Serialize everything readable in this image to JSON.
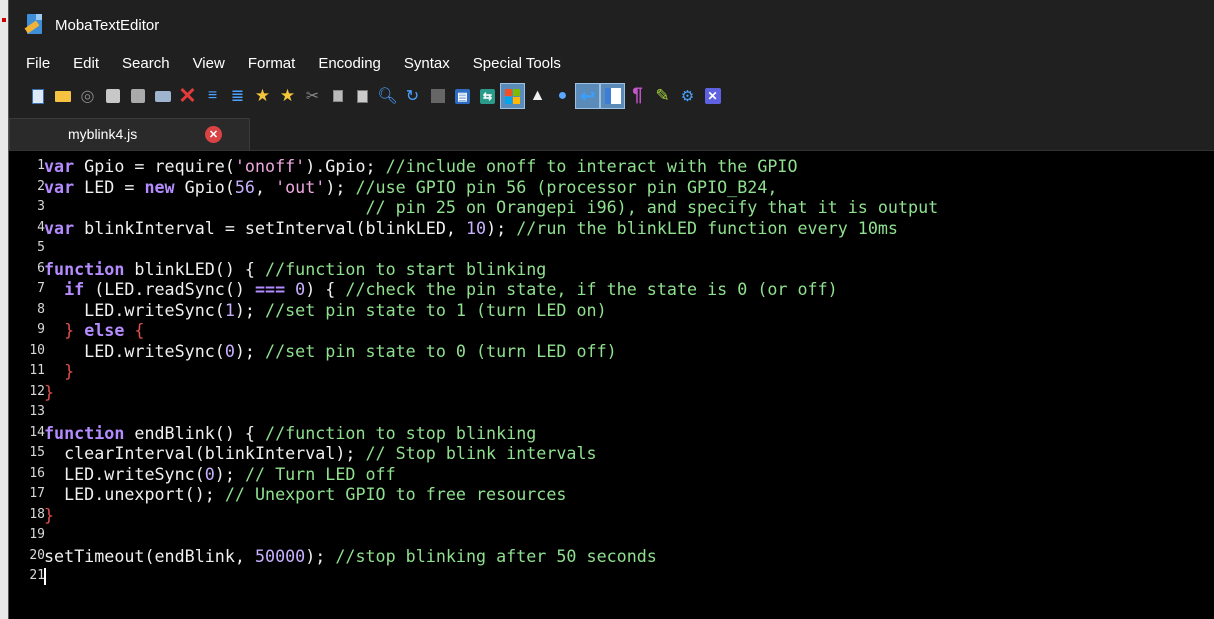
{
  "window": {
    "title": "MobaTextEditor",
    "app_icon": "mobatexteditor-icon"
  },
  "menu": [
    "File",
    "Edit",
    "Search",
    "View",
    "Format",
    "Encoding",
    "Syntax",
    "Special Tools"
  ],
  "toolbar": {
    "icons": [
      "new-file-icon",
      "open-folder-icon",
      "reload-icon",
      "save-icon",
      "save-all-icon",
      "print-icon",
      "close-icon",
      "indent-less-icon",
      "indent-more-icon",
      "bookmark-icon",
      "bookmark-next-icon",
      "cut-icon",
      "copy-icon",
      "paste-icon",
      "find-icon",
      "replace-icon",
      "compare-icon",
      "split-view-icon",
      "sync-icon",
      "windows-eol-icon",
      "linux-eol-icon",
      "mac-eol-icon",
      "word-wrap-icon",
      "side-panel-icon",
      "show-symbols-icon",
      "highlight-icon",
      "settings-icon",
      "exit-icon"
    ],
    "active_icons": [
      "windows-eol-icon",
      "word-wrap-icon",
      "side-panel-icon"
    ]
  },
  "tabs": [
    {
      "label": "myblink4.js",
      "closable": true
    }
  ],
  "editor": {
    "language": "javascript",
    "lines": [
      {
        "n": "1",
        "tokens": [
          [
            "kw",
            "var"
          ],
          [
            "t",
            " Gpio = require("
          ],
          [
            "str",
            "'onoff'"
          ],
          [
            "t",
            ").Gpio; "
          ],
          [
            "cm",
            "//include onoff to interact with the GPIO"
          ]
        ]
      },
      {
        "n": "2",
        "tokens": [
          [
            "kw",
            "var"
          ],
          [
            "t",
            " LED = "
          ],
          [
            "kw",
            "new"
          ],
          [
            "t",
            " Gpio("
          ],
          [
            "num",
            "56"
          ],
          [
            "t",
            ", "
          ],
          [
            "str",
            "'out'"
          ],
          [
            "t",
            "); "
          ],
          [
            "cm",
            "//use GPIO pin 56 (processor pin GPIO_B24,"
          ]
        ]
      },
      {
        "n": "3",
        "tokens": [
          [
            "t",
            "                                "
          ],
          [
            "cm",
            "// pin 25 on Orangepi i96), and specify that it is output"
          ]
        ]
      },
      {
        "n": "4",
        "tokens": [
          [
            "kw",
            "var"
          ],
          [
            "t",
            " blinkInterval = setInterval(blinkLED, "
          ],
          [
            "num",
            "10"
          ],
          [
            "t",
            "); "
          ],
          [
            "cm",
            "//run the blinkLED function every 10ms"
          ]
        ]
      },
      {
        "n": "5",
        "tokens": []
      },
      {
        "n": "6",
        "tokens": [
          [
            "kw",
            "function"
          ],
          [
            "t",
            " blinkLED() { "
          ],
          [
            "cm",
            "//function to start blinking"
          ]
        ]
      },
      {
        "n": "7",
        "tokens": [
          [
            "t",
            "  "
          ],
          [
            "kw",
            "if"
          ],
          [
            "t",
            " (LED.readSync() "
          ],
          [
            "kw",
            "==="
          ],
          [
            "t",
            " "
          ],
          [
            "num",
            "0"
          ],
          [
            "t",
            ") { "
          ],
          [
            "cm",
            "//check the pin state, if the state is 0 (or off)"
          ]
        ]
      },
      {
        "n": "8",
        "tokens": [
          [
            "t",
            "    LED.writeSync("
          ],
          [
            "num",
            "1"
          ],
          [
            "t",
            "); "
          ],
          [
            "cm",
            "//set pin state to 1 (turn LED on)"
          ]
        ]
      },
      {
        "n": "9",
        "tokens": [
          [
            "t",
            "  "
          ],
          [
            "br",
            "}"
          ],
          [
            "t",
            " "
          ],
          [
            "kw",
            "else"
          ],
          [
            "t",
            " "
          ],
          [
            "br",
            "{"
          ]
        ]
      },
      {
        "n": "10",
        "tokens": [
          [
            "t",
            "    LED.writeSync("
          ],
          [
            "num",
            "0"
          ],
          [
            "t",
            "); "
          ],
          [
            "cm",
            "//set pin state to 0 (turn LED off)"
          ]
        ]
      },
      {
        "n": "11",
        "tokens": [
          [
            "t",
            "  "
          ],
          [
            "br",
            "}"
          ]
        ]
      },
      {
        "n": "12",
        "tokens": [
          [
            "br",
            "}"
          ]
        ]
      },
      {
        "n": "13",
        "tokens": []
      },
      {
        "n": "14",
        "tokens": [
          [
            "kw",
            "function"
          ],
          [
            "t",
            " endBlink() { "
          ],
          [
            "cm",
            "//function to stop blinking"
          ]
        ]
      },
      {
        "n": "15",
        "tokens": [
          [
            "t",
            "  clearInterval(blinkInterval); "
          ],
          [
            "cm",
            "// Stop blink intervals"
          ]
        ]
      },
      {
        "n": "16",
        "tokens": [
          [
            "t",
            "  LED.writeSync("
          ],
          [
            "num",
            "0"
          ],
          [
            "t",
            "); "
          ],
          [
            "cm",
            "// Turn LED off"
          ]
        ]
      },
      {
        "n": "17",
        "tokens": [
          [
            "t",
            "  LED.unexport(); "
          ],
          [
            "cm",
            "// Unexport GPIO to free resources"
          ]
        ]
      },
      {
        "n": "18",
        "tokens": [
          [
            "br",
            "}"
          ]
        ]
      },
      {
        "n": "19",
        "tokens": []
      },
      {
        "n": "20",
        "tokens": [
          [
            "t",
            "setTimeout(endBlink, "
          ],
          [
            "num",
            "50000"
          ],
          [
            "t",
            "); "
          ],
          [
            "cm",
            "//stop blinking after 50 seconds"
          ]
        ]
      },
      {
        "n": "21",
        "tokens": [],
        "cursor": true
      }
    ]
  },
  "colors": {
    "keyword": "#b58cff",
    "string": "#f0a8e0",
    "number": "#c8b0ff",
    "comment": "#8fe08f",
    "brace": "#e05050",
    "background": "#000000"
  }
}
